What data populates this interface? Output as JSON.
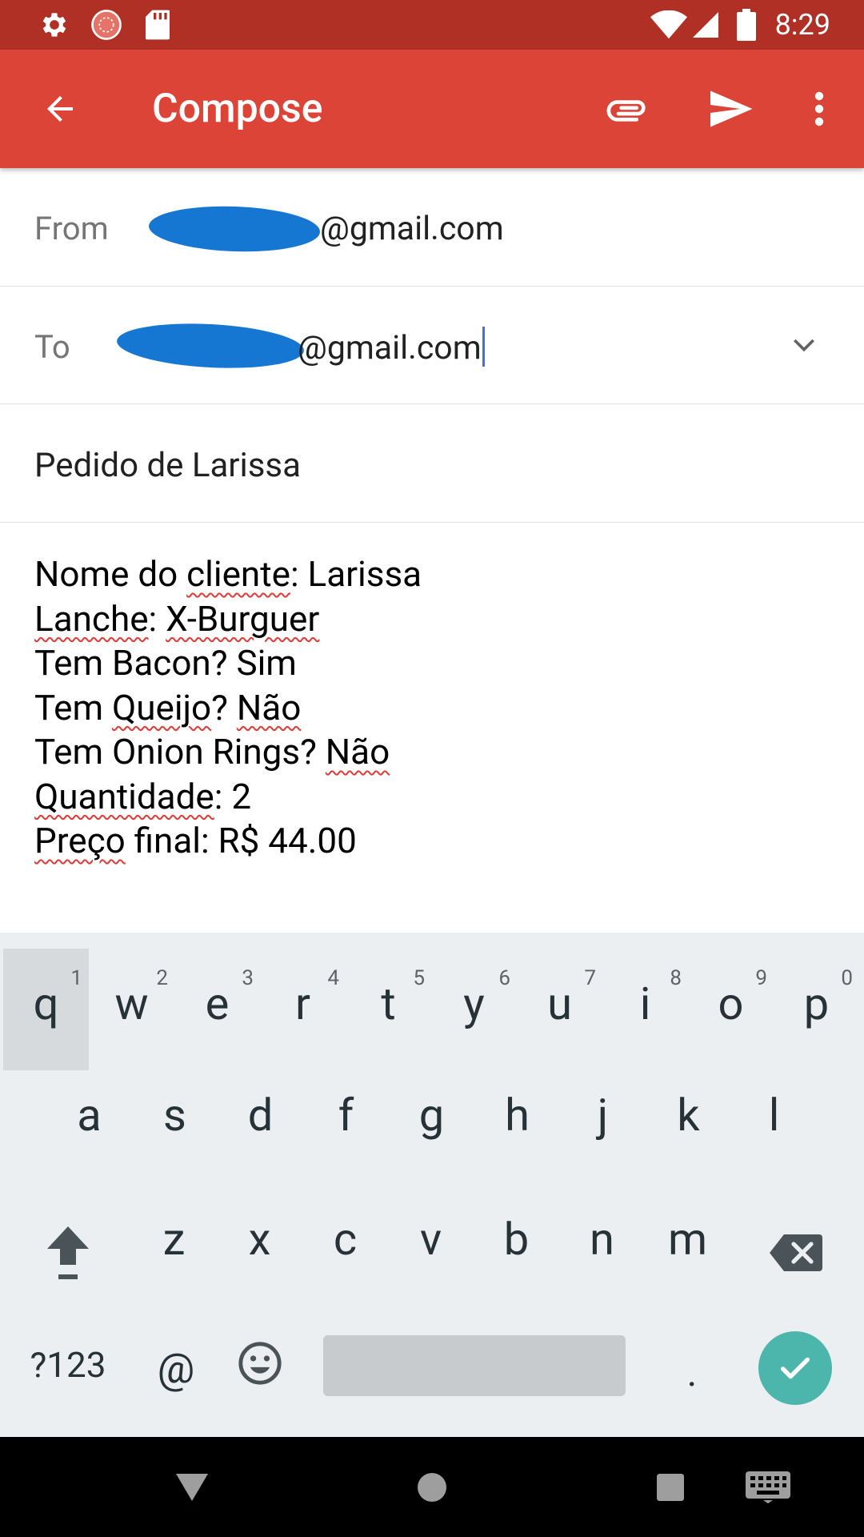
{
  "status_bar": {
    "time": "8:29",
    "icons": [
      "settings-icon",
      "sync-icon",
      "sd-card-icon",
      "wifi-icon",
      "signal-icon",
      "battery-icon"
    ]
  },
  "app_bar": {
    "title": "Compose",
    "background_color": "#db4437",
    "status_color": "#b03026",
    "actions": [
      "back-arrow-icon",
      "attach-icon",
      "send-icon",
      "more-vert-icon"
    ]
  },
  "compose": {
    "from": {
      "label": "From",
      "value": "@gmail.com"
    },
    "to": {
      "label": "To",
      "value": "@gmail.com"
    },
    "subject": "Pedido de Larissa",
    "body_lines": [
      [
        "Nome do ",
        "cliente",
        ": Larissa"
      ],
      [
        "Lanche",
        ": ",
        "X-Burguer"
      ],
      [
        "Tem Bacon? Sim"
      ],
      [
        "Tem ",
        "Queijo",
        "? ",
        "Não"
      ],
      [
        "Tem Onion Rings? ",
        "Não"
      ],
      [
        "Quantidade",
        ": 2"
      ],
      [
        "Preço",
        " final: R$ 44.00"
      ]
    ]
  },
  "keyboard": {
    "row1": [
      {
        "k": "q",
        "h": "1"
      },
      {
        "k": "w",
        "h": "2"
      },
      {
        "k": "e",
        "h": "3"
      },
      {
        "k": "r",
        "h": "4"
      },
      {
        "k": "t",
        "h": "5"
      },
      {
        "k": "y",
        "h": "6"
      },
      {
        "k": "u",
        "h": "7"
      },
      {
        "k": "i",
        "h": "8"
      },
      {
        "k": "o",
        "h": "9"
      },
      {
        "k": "p",
        "h": "0"
      }
    ],
    "row2": [
      "a",
      "s",
      "d",
      "f",
      "g",
      "h",
      "j",
      "k",
      "l"
    ],
    "row3": [
      "z",
      "x",
      "c",
      "v",
      "b",
      "n",
      "m"
    ],
    "symbols_label": "?123",
    "at_label": "@",
    "period_label": ".",
    "accent_color": "#4db6ac"
  },
  "nav_bar": {
    "icons": [
      "back-triangle-icon",
      "home-circle-icon",
      "recents-square-icon",
      "keyboard-icon"
    ]
  }
}
